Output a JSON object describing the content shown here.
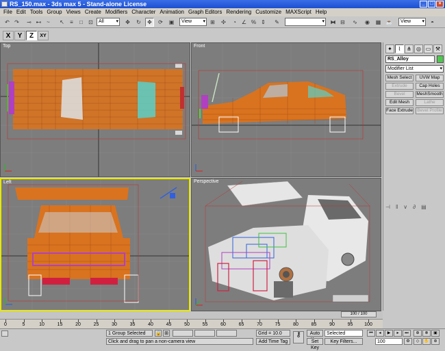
{
  "window": {
    "title": "RS_150.max - 3ds max 5 - Stand-alone License",
    "minimize": "_",
    "maximize": "□",
    "close": "×"
  },
  "menu": [
    "File",
    "Edit",
    "Tools",
    "Group",
    "Views",
    "Create",
    "Modifiers",
    "Character",
    "Animation",
    "Graph Editors",
    "Rendering",
    "Customize",
    "MAXScript",
    "Help"
  ],
  "toolbar": {
    "selection_filter": "All",
    "ref_coord": "View",
    "named_selection": "",
    "render_type": "View"
  },
  "axis_constraints": [
    {
      "label": "X",
      "active": false
    },
    {
      "label": "Y",
      "active": false
    },
    {
      "label": "Z",
      "active": true
    },
    {
      "label": "XY",
      "active": false
    }
  ],
  "viewports": {
    "top": "Top",
    "front": "Front",
    "left": "Left",
    "perspective": "Perspective"
  },
  "command_panel": {
    "object_name": "RS_Alloy",
    "object_color": "#50c850",
    "modifier_list": "Modifier List",
    "buttons": [
      {
        "label": "Mesh Select",
        "enabled": true
      },
      {
        "label": "UVW Map",
        "enabled": true
      },
      {
        "label": "Extrude",
        "enabled": false
      },
      {
        "label": "Cap Holes",
        "enabled": true
      },
      {
        "label": "Bevel",
        "enabled": false
      },
      {
        "label": "MeshSmooth",
        "enabled": true
      },
      {
        "label": "Edit Mesh",
        "enabled": true
      },
      {
        "label": "Lathe",
        "enabled": false
      },
      {
        "label": "Face Extrude",
        "enabled": true
      },
      {
        "label": "Bevel Profile",
        "enabled": false
      }
    ]
  },
  "timeline": {
    "slider": "100 / 100",
    "ticks": [
      "0",
      "5",
      "10",
      "15",
      "20",
      "25",
      "30",
      "35",
      "40",
      "45",
      "50",
      "55",
      "60",
      "65",
      "70",
      "75",
      "80",
      "85",
      "90",
      "95",
      "100"
    ]
  },
  "status": {
    "selection": "1 Group Selected",
    "prompt": "Click and drag to pan a non-camera view",
    "grid": "Grid = 10.0",
    "add_time_tag": "Add Time Tag",
    "auto_key": "Auto Key",
    "set_key": "Set Key",
    "key_mode": "Selected",
    "key_filters": "Key Filters...",
    "frame": "100"
  },
  "colors": {
    "viewport_bg": "#7d7d7d",
    "wire_orange": "#d9731f",
    "active_border": "#e8e800"
  }
}
